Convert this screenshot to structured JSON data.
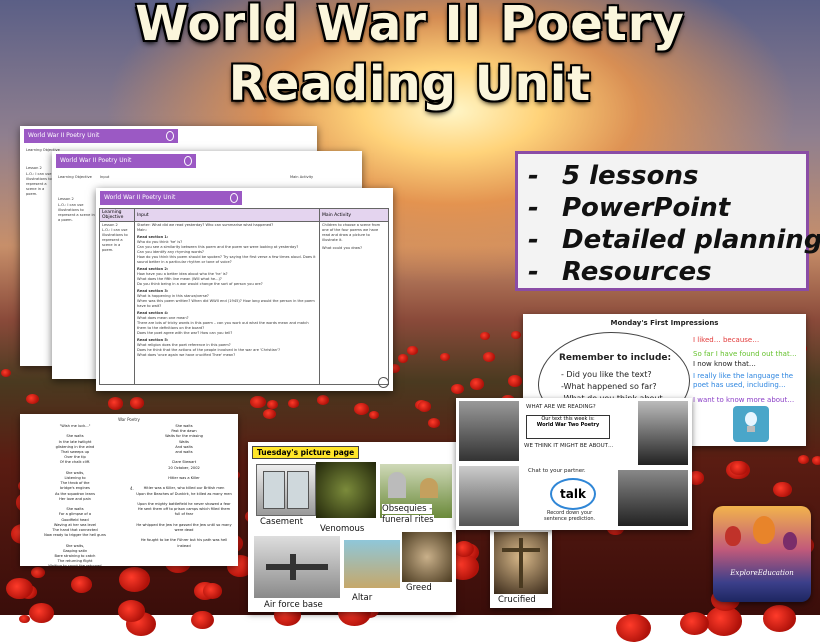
{
  "title": {
    "line1": "World War II Poetry",
    "line2": "Reading Unit"
  },
  "features": {
    "items": [
      "5 lessons",
      "PowerPoint",
      "Detailed planning",
      "Resources"
    ],
    "bullet": "-"
  },
  "planning": {
    "header": "World War II Poetry Unit",
    "columns": [
      "Learning Objective",
      "Input",
      "Main Activity"
    ],
    "lesson": "Lesson 2",
    "objective": "L.O.: I can use illustrations to represent a scene in a poem.",
    "starter": "Starter: What did we read yesterday? Who can summarise what happened?",
    "main_heading": "Main:",
    "sections": [
      "Read section 1:",
      "Who do you think 'he' is?",
      "Can you see a similarity between this poem and the poem we were looking at yesterday?",
      "Can you identify any rhyming words?",
      "How do you think this poem should be spoken? Try saying the first verse a few times aloud. Does it sound better in a particular rhythm or tone of voice?",
      "Read section 2:",
      "How have you a better idea about who the 'he' is?",
      "What does the fifth line mean (Will what he...)?",
      "Do you think being in a war would change the sort of person you are?",
      "Read section 3:",
      "What is happening in this stanza/verse?",
      "When was this poem written? When did WWII end (1945)? How long would the person in the poem have to wait?",
      "Read section 4:",
      "What does mean one mean?",
      "There are lots of tricky words in this poem – can you work out what the words mean and match them to the definitions on the board?",
      "Does the poet agree with the war? How can you tell?",
      "Read section 5:",
      "What religion does the poet reference in this poem?",
      "Does he think that the actions of the people involved in the war are 'Christian'?",
      "What does 'once again we have crucified Thee' mean?"
    ],
    "activity": "Children to choose a scene from one of the four poems we have read and draw a picture to illustrate it.",
    "activity2": "What could you draw?"
  },
  "impressions": {
    "heading": "Monday's First Impressions",
    "remember": "Remember to include:",
    "bullets": [
      "- Did you like the text?",
      "-What happened so far?",
      "-What do you think about"
    ],
    "stems": [
      {
        "text": "I liked… because…",
        "color": "#e23a3a"
      },
      {
        "text": "So far I have found out that…",
        "color": "#66c22e"
      },
      {
        "text": "I now know that…",
        "color": "#222222"
      },
      {
        "text": "I really like the language the",
        "color": "#2e86e0"
      },
      {
        "text": "poet has used, including…",
        "color": "#2e86e0"
      },
      {
        "text": "I want to know more about…",
        "color": "#8b3fc7"
      }
    ]
  },
  "poem": {
    "header": "War Poetry",
    "left": [
      "\"Wish me luck...\"",
      "",
      "She waits",
      "In the late twilight",
      "glistening in the wind",
      "That sweeps up",
      "Over the tip",
      "Of the chalk cliff.",
      "",
      "She waits,",
      "Listening to",
      "The throb of the",
      "bridge's engines",
      "As the squadron leans",
      "Her love and pain",
      "",
      "She waits",
      "For a glimpse of a",
      "Goodfield head",
      "Waving at her sea level",
      "The hand that connected",
      "Now ready to trigger the hell guns",
      "",
      "She waits,",
      "Gasping satin",
      "Bare straining to catch",
      "The returning flight",
      "Waiting to count the returned",
      "and the missing"
    ],
    "right": [
      "She waits",
      "Past the dawn",
      "Waits for the missing",
      "Waits",
      "And waits",
      "and waits",
      "",
      "Clare Stewart",
      "20 October, 2002",
      "",
      "Hitler was a Killer",
      "",
      "Hitler was a Killer, who killed our British men",
      "Upon the Beaches of Dunkirk, he killed as many men",
      "",
      "Upon the mighty battlefield he never showed a fear",
      "He sent them off to prison camps which filled them full of fear",
      "",
      "He whipped the Jew he gassed the Jew until so many were dead",
      "",
      "He fought to be the Führer but his path was hell instead"
    ],
    "marker": "4."
  },
  "picture_page": {
    "tag": "Tuesday's picture page",
    "labels": [
      "Casement",
      "Venomous",
      "Obsequies -",
      "funeral rites",
      "Air force base",
      "Altar",
      "Greed",
      "Crucified"
    ]
  },
  "reading": {
    "question": "WHAT ARE WE READING?",
    "box_line1": "Our text this week is:",
    "box_line2": "World War Two Poetry",
    "think": "WE THINK IT MIGHT BE ABOUT…",
    "chat": "Chat to your partner.",
    "talk": "talk",
    "record1": "Record down your",
    "record2": "sentence prediction."
  },
  "logo": {
    "text": "ExploreEducation"
  },
  "colors": {
    "accent": "#9b59c4",
    "title_text": "#fbf6dc",
    "poppy": "#d8190e"
  }
}
